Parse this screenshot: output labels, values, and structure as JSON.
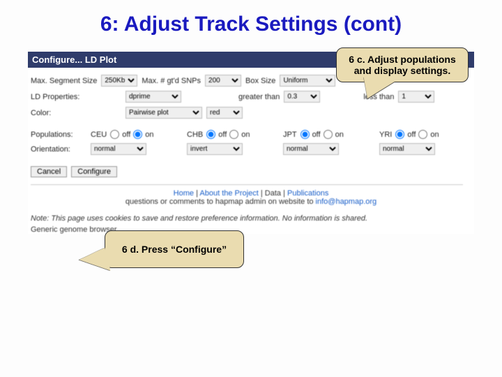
{
  "title": "6: Adjust Track Settings (cont)",
  "panel": {
    "header": "Configure... LD Plot"
  },
  "callouts": {
    "c": "6 c. Adjust populations and display settings.",
    "d": "6 d. Press “Configure”"
  },
  "row1": {
    "seg_label": "Max. Segment Size",
    "seg_val": "250Kb",
    "snp_label": "Max. # gt'd SNPs",
    "snp_val": "200",
    "box_label": "Box Size",
    "box_val": "Uniform"
  },
  "row2": {
    "label": "LD Properties:",
    "prop_val": "dprime",
    "gt_label": "greater than",
    "gt_val": "0.3",
    "lt_label": "less than",
    "lt_val": "1"
  },
  "row3": {
    "label": "Color:",
    "scheme_val": "Pairwise plot",
    "palette_val": "red"
  },
  "row4": {
    "label": "Populations:",
    "off": "off",
    "on": "on",
    "pops": [
      "CEU",
      "CHB",
      "JPT",
      "YRI"
    ],
    "states": [
      "on",
      "off",
      "off",
      "off"
    ]
  },
  "row5": {
    "label": "Orientation:",
    "vals": [
      "normal",
      "invert",
      "normal",
      "normal"
    ]
  },
  "buttons": {
    "cancel": "Cancel",
    "configure": "Configure"
  },
  "footer": {
    "links": [
      "Home",
      "About the Project",
      "Data",
      "Publications"
    ],
    "contact_pre": "questions or comments to hapmap admin on website to ",
    "contact_email": "info@hapmap.org",
    "note": "Note: This page uses cookies to save and restore preference information. No information is shared.",
    "gb": "Generic genome browser"
  }
}
